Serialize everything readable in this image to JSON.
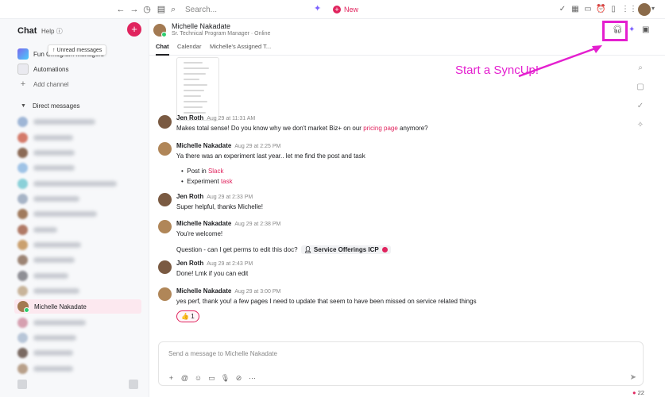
{
  "topbar": {
    "search_placeholder": "Search...",
    "new_label": "New"
  },
  "sidebar": {
    "title": "Chat",
    "help_label": "Help",
    "tooltip": "Unread messages",
    "channel_partial": "Fun C...ogram Managers",
    "automations_label": "Automations",
    "add_channel_label": "Add channel",
    "direct_messages_label": "Direct messages",
    "active_dm_name": "Michelle Nakadate"
  },
  "header": {
    "name": "Michelle Nakadate",
    "subtitle": "Sr. Technical Program Manager · Online",
    "tabs": [
      "Chat",
      "Calendar",
      "Michelle's Assigned T..."
    ]
  },
  "annotation": {
    "text": "Start a SyncUp!",
    "color": "#e41fcf"
  },
  "messages": [
    {
      "author": "Jen Roth",
      "time": "Aug 29 at 11:31 AM",
      "text_before": "Makes total sense! Do you know why we don't market Biz+ on our ",
      "link": "pricing page",
      "text_after": " anymore?"
    },
    {
      "author": "Michelle Nakadate",
      "time": "Aug 29 at 2:25 PM",
      "text": "Ya there was an experiment last year.. let me find the post and task",
      "bullets": [
        {
          "prefix": "Post in ",
          "link": "Slack"
        },
        {
          "prefix": "Experiment ",
          "link": "task"
        }
      ]
    },
    {
      "author": "Jen Roth",
      "time": "Aug 29 at 2:33 PM",
      "text": "Super helpful, thanks Michelle!"
    },
    {
      "author": "Michelle Nakadate",
      "time": "Aug 29 at 2:38 PM",
      "text": "You're welcome!",
      "text2": "Question - can I get perms to edit this doc?",
      "doc_chip": "Service Offerings ICP"
    },
    {
      "author": "Jen Roth",
      "time": "Aug 29 at 2:43 PM",
      "text": "Done! Lmk if you can edit"
    },
    {
      "author": "Michelle Nakadate",
      "time": "Aug 29 at 3:00 PM",
      "text": "yes perf, thank you! a few pages I need to update that seem to have been missed on service related things",
      "reaction_emoji": "👍",
      "reaction_count": "1"
    }
  ],
  "composer": {
    "placeholder": "Send a message to Michelle Nakadate"
  },
  "status": {
    "notification_count": "22"
  },
  "colors": {
    "accent": "#e0245e",
    "annotation": "#e41fcf"
  }
}
